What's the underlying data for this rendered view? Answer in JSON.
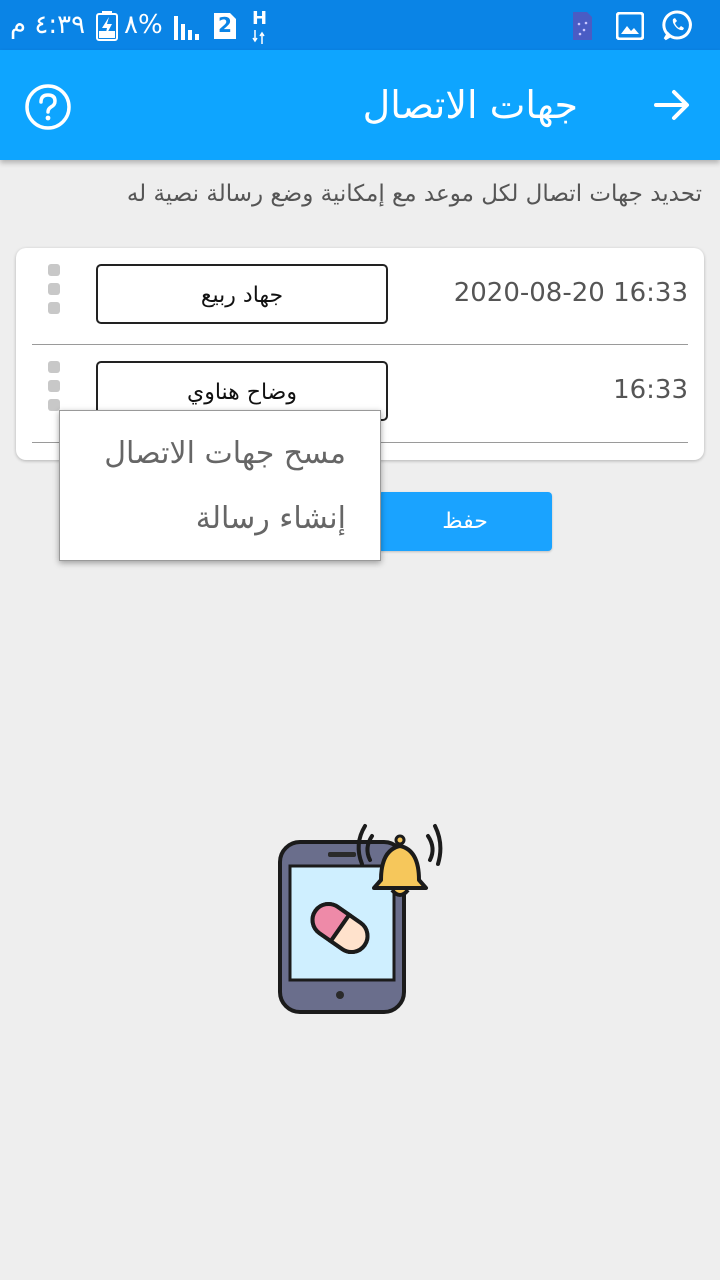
{
  "status_bar": {
    "time": "٤:٣٩ م",
    "battery_percent": "٨%",
    "sim_label": "2",
    "network_label": "H",
    "icons": [
      "whatsapp-icon",
      "gallery-icon",
      "sim-card-icon",
      "signal-icon",
      "battery-charging-icon"
    ]
  },
  "app_bar": {
    "title": "جهات الاتصال",
    "back_icon": "arrow-right-icon",
    "help_icon": "help-circle-icon"
  },
  "description": "تحديد جهات اتصال لكل موعد مع إمكانية وضع رسالة نصية له",
  "rows": [
    {
      "time": "2020-08-20 16:33",
      "contact": "جهاد ربيع"
    },
    {
      "time": "16:33",
      "contact": "وضاح هناوي"
    }
  ],
  "save_label": "حفظ",
  "popup_menu": {
    "items": [
      "مسح جهات الاتصال",
      "إنشاء رسالة"
    ]
  },
  "colors": {
    "status_bar": "#0a84e6",
    "app_bar": "#0ea5ff",
    "save_button": "#1aa3ff",
    "background": "#eeeeee"
  }
}
